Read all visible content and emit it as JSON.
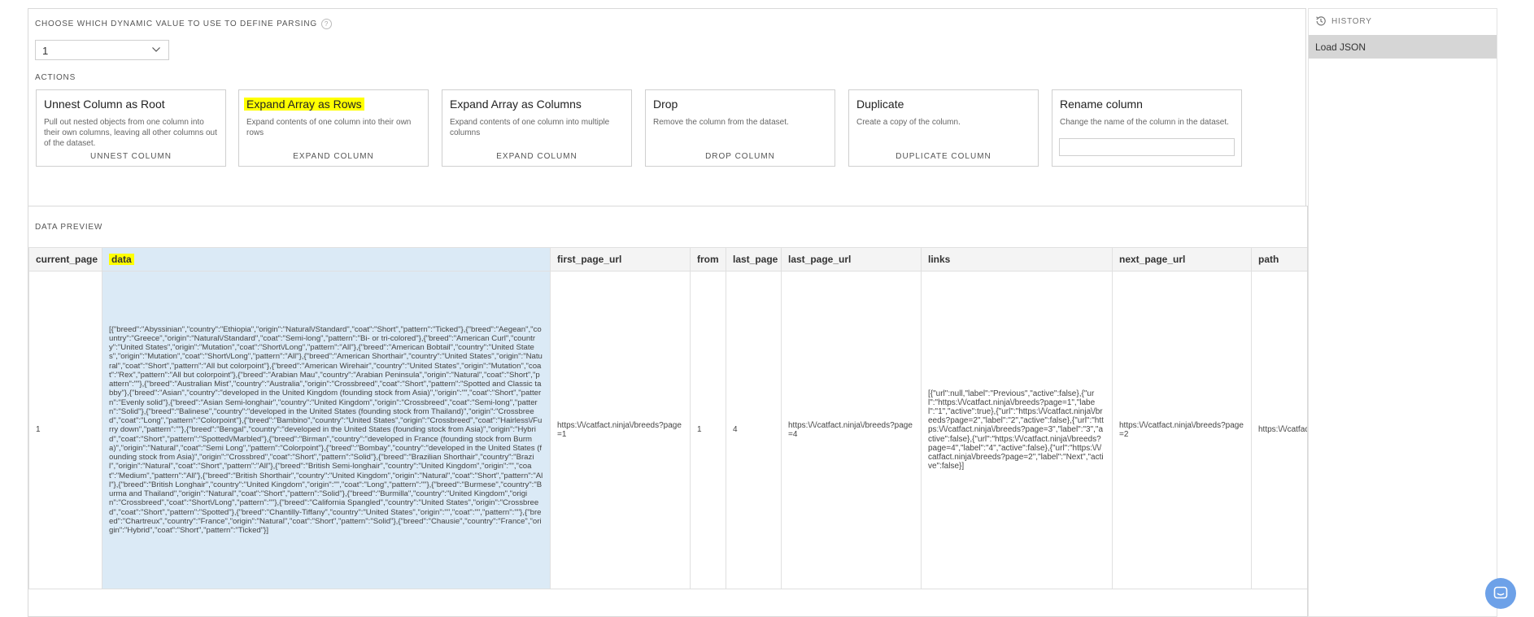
{
  "parsing": {
    "label": "CHOOSE WHICH DYNAMIC VALUE TO USE TO DEFINE PARSING",
    "help_glyph": "?",
    "selected_value": "1"
  },
  "actions": {
    "label": "ACTIONS",
    "cards": [
      {
        "title": "Unnest Column as Root",
        "description": "Pull out nested objects from one column into their own columns, leaving all other columns out of the dataset.",
        "action": "UNNEST COLUMN",
        "highlighted": false
      },
      {
        "title": "Expand Array as Rows",
        "description": "Expand contents of one column into their own rows",
        "action": "EXPAND COLUMN",
        "highlighted": true
      },
      {
        "title": "Expand Array as Columns",
        "description": "Expand contents of one column into multiple columns",
        "action": "EXPAND COLUMN",
        "highlighted": false
      },
      {
        "title": "Drop",
        "description": "Remove the column from the dataset.",
        "action": "DROP COLUMN",
        "highlighted": false
      },
      {
        "title": "Duplicate",
        "description": "Create a copy of the column.",
        "action": "DUPLICATE COLUMN",
        "highlighted": false
      },
      {
        "title": "Rename column",
        "description": "Change the name of the column in the dataset.",
        "action": "",
        "highlighted": false
      }
    ]
  },
  "history": {
    "label": "HISTORY",
    "items": [
      "Load JSON"
    ]
  },
  "preview": {
    "label": "DATA PREVIEW",
    "columns": [
      "current_page",
      "data",
      "first_page_url",
      "from",
      "last_page",
      "last_page_url",
      "links",
      "next_page_url",
      "path"
    ],
    "row": {
      "current_page": "1",
      "data": "[{\"breed\":\"Abyssinian\",\"country\":\"Ethiopia\",\"origin\":\"Natural\\/Standard\",\"coat\":\"Short\",\"pattern\":\"Ticked\"},{\"breed\":\"Aegean\",\"country\":\"Greece\",\"origin\":\"Natural\\/Standard\",\"coat\":\"Semi-long\",\"pattern\":\"Bi- or tri-colored\"},{\"breed\":\"American Curl\",\"country\":\"United States\",\"origin\":\"Mutation\",\"coat\":\"Short\\/Long\",\"pattern\":\"All\"},{\"breed\":\"American Bobtail\",\"country\":\"United States\",\"origin\":\"Mutation\",\"coat\":\"Short\\/Long\",\"pattern\":\"All\"},{\"breed\":\"American Shorthair\",\"country\":\"United States\",\"origin\":\"Natural\",\"coat\":\"Short\",\"pattern\":\"All but colorpoint\"},{\"breed\":\"American Wirehair\",\"country\":\"United States\",\"origin\":\"Mutation\",\"coat\":\"Rex\",\"pattern\":\"All but colorpoint\"},{\"breed\":\"Arabian Mau\",\"country\":\"Arabian Peninsula\",\"origin\":\"Natural\",\"coat\":\"Short\",\"pattern\":\"\"},{\"breed\":\"Australian Mist\",\"country\":\"Australia\",\"origin\":\"Crossbreed\",\"coat\":\"Short\",\"pattern\":\"Spotted and Classic tabby\"},{\"breed\":\"Asian\",\"country\":\"developed in the United Kingdom (founding stock from Asia)\",\"origin\":\"\",\"coat\":\"Short\",\"pattern\":\"Evenly solid\"},{\"breed\":\"Asian Semi-longhair\",\"country\":\"United Kingdom\",\"origin\":\"Crossbreed\",\"coat\":\"Semi-long\",\"pattern\":\"Solid\"},{\"breed\":\"Balinese\",\"country\":\"developed in the United States (founding stock from Thailand)\",\"origin\":\"Crossbreed\",\"coat\":\"Long\",\"pattern\":\"Colorpoint\"},{\"breed\":\"Bambino\",\"country\":\"United States\",\"origin\":\"Crossbreed\",\"coat\":\"Hairless\\/Furry down\",\"pattern\":\"\"},{\"breed\":\"Bengal\",\"country\":\"developed in the United States (founding stock from Asia)\",\"origin\":\"Hybrid\",\"coat\":\"Short\",\"pattern\":\"Spotted\\/Marbled\"},{\"breed\":\"Birman\",\"country\":\"developed in France (founding stock from Burma)\",\"origin\":\"Natural\",\"coat\":\"Semi Long\",\"pattern\":\"Colorpoint\"},{\"breed\":\"Bombay\",\"country\":\"developed in the United States (founding stock from Asia)\",\"origin\":\"Crossbred\",\"coat\":\"Short\",\"pattern\":\"Solid\"},{\"breed\":\"Brazilian Shorthair\",\"country\":\"Brazil\",\"origin\":\"Natural\",\"coat\":\"Short\",\"pattern\":\"All\"},{\"breed\":\"British Semi-longhair\",\"country\":\"United Kingdom\",\"origin\":\"\",\"coat\":\"Medium\",\"pattern\":\"All\"},{\"breed\":\"British Shorthair\",\"country\":\"United Kingdom\",\"origin\":\"Natural\",\"coat\":\"Short\",\"pattern\":\"All\"},{\"breed\":\"British Longhair\",\"country\":\"United Kingdom\",\"origin\":\"\",\"coat\":\"Long\",\"pattern\":\"\"},{\"breed\":\"Burmese\",\"country\":\"Burma and Thailand\",\"origin\":\"Natural\",\"coat\":\"Short\",\"pattern\":\"Solid\"},{\"breed\":\"Burmilla\",\"country\":\"United Kingdom\",\"origin\":\"Crossbreed\",\"coat\":\"Short\\/Long\",\"pattern\":\"\"},{\"breed\":\"California Spangled\",\"country\":\"United States\",\"origin\":\"Crossbreed\",\"coat\":\"Short\",\"pattern\":\"Spotted\"},{\"breed\":\"Chantilly-Tiffany\",\"country\":\"United States\",\"origin\":\"\",\"coat\":\"\",\"pattern\":\"\"},{\"breed\":\"Chartreux\",\"country\":\"France\",\"origin\":\"Natural\",\"coat\":\"Short\",\"pattern\":\"Solid\"},{\"breed\":\"Chausie\",\"country\":\"France\",\"origin\":\"Hybrid\",\"coat\":\"Short\",\"pattern\":\"Ticked\"}]",
      "first_page_url": "https:\\/\\/catfact.ninja\\/breeds?page=1",
      "from": "1",
      "last_page": "4",
      "last_page_url": "https:\\/\\/catfact.ninja\\/breeds?page=4",
      "links": "[{\"url\":null,\"label\":\"Previous\",\"active\":false},{\"url\":\"https:\\/\\/catfact.ninja\\/breeds?page=1\",\"label\":\"1\",\"active\":true},{\"url\":\"https:\\/\\/catfact.ninja\\/breeds?page=2\",\"label\":\"2\",\"active\":false},{\"url\":\"https:\\/\\/catfact.ninja\\/breeds?page=3\",\"label\":\"3\",\"active\":false},{\"url\":\"https:\\/\\/catfact.ninja\\/breeds?page=4\",\"label\":\"4\",\"active\":false},{\"url\":\"https:\\/\\/catfact.ninja\\/breeds?page=2\",\"label\":\"Next\",\"active\":false}]",
      "next_page_url": "https:\\/\\/catfact.ninja\\/breeds?page=2",
      "path": "https:\\/\\/catfact.ninja\\/breeds"
    }
  },
  "colors": {
    "highlight": "#ffff00",
    "selected_column": "#dbeaf6",
    "history_selected": "#d6d6d6",
    "chat_button": "#6da1e8"
  },
  "icons": [
    "chevron-down-icon",
    "help-icon",
    "history-icon",
    "chat-icon"
  ]
}
